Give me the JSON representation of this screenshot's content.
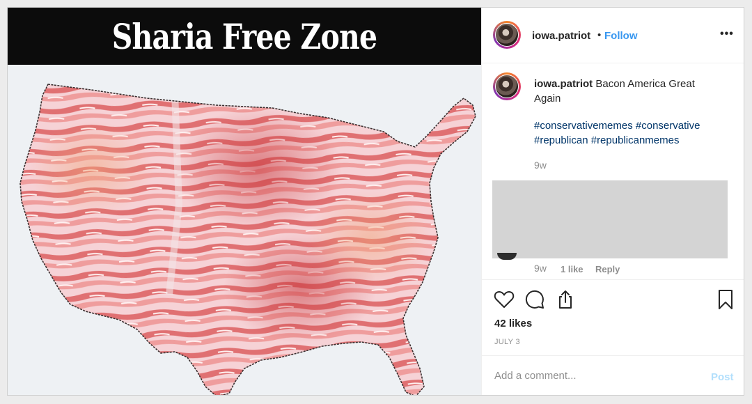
{
  "post_image": {
    "meme_title": "Sharia Free Zone",
    "colors": {
      "banner": "#0c0c0c",
      "bacon_dark": "#d9595a",
      "bacon_light": "#f6d2d6",
      "fat": "#f5ece9"
    }
  },
  "header": {
    "username": "iowa.patriot",
    "separator": "•",
    "follow_label": "Follow",
    "more_icon": "more-options-icon",
    "more_glyph": "•••"
  },
  "caption": {
    "username": "iowa.patriot",
    "text": "Bacon America Great Again",
    "hashtags": "#conservativememes #conservative #republican #republicanmemes",
    "time": "9w"
  },
  "comment": {
    "time": "9w",
    "likes": "1 like",
    "reply_label": "Reply"
  },
  "actions": {
    "icons": [
      "heart-icon",
      "comment-icon",
      "share-icon",
      "bookmark-icon"
    ],
    "likes": "42 likes",
    "date": "JULY 3"
  },
  "add_comment": {
    "placeholder": "Add a comment...",
    "post_label": "Post"
  },
  "colors": {
    "link": "#3897f0",
    "hashtag": "#003569",
    "muted": "#8e8e8e",
    "post_disabled": "#b2dffc"
  }
}
